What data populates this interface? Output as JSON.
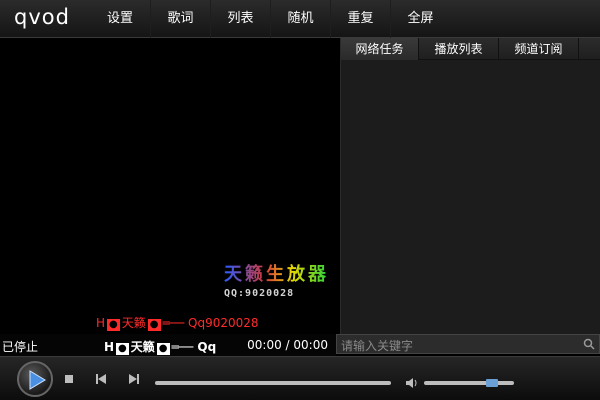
{
  "app": {
    "logo": "qvod"
  },
  "menu": {
    "items": [
      "设置",
      "歌词",
      "列表",
      "随机",
      "重复",
      "全屏"
    ]
  },
  "panel": {
    "tabs": [
      "网络任务",
      "播放列表",
      "频道订阅"
    ]
  },
  "video": {
    "watermark_title": "天籁生放器",
    "watermark_sub": "QQ:9020028",
    "caption_prefix": "H",
    "caption_box1": "●",
    "caption_name": "天籁",
    "caption_box2": "●",
    "caption_tail": "═── Qq9020028"
  },
  "status": {
    "text": "已停止",
    "scroll_prefix": "H",
    "scroll_box1": "●",
    "scroll_name": "天籁",
    "scroll_box2": "●",
    "scroll_tail": "═── Qq9020028",
    "time": "00:00 / 00:00"
  },
  "search": {
    "placeholder": "请输入关键字"
  },
  "controls": {
    "progress": 0.0,
    "volume": 0.7
  },
  "colors": {
    "accent": "#6aa0d6",
    "caption": "#ff2a2a",
    "background": "#000000"
  }
}
